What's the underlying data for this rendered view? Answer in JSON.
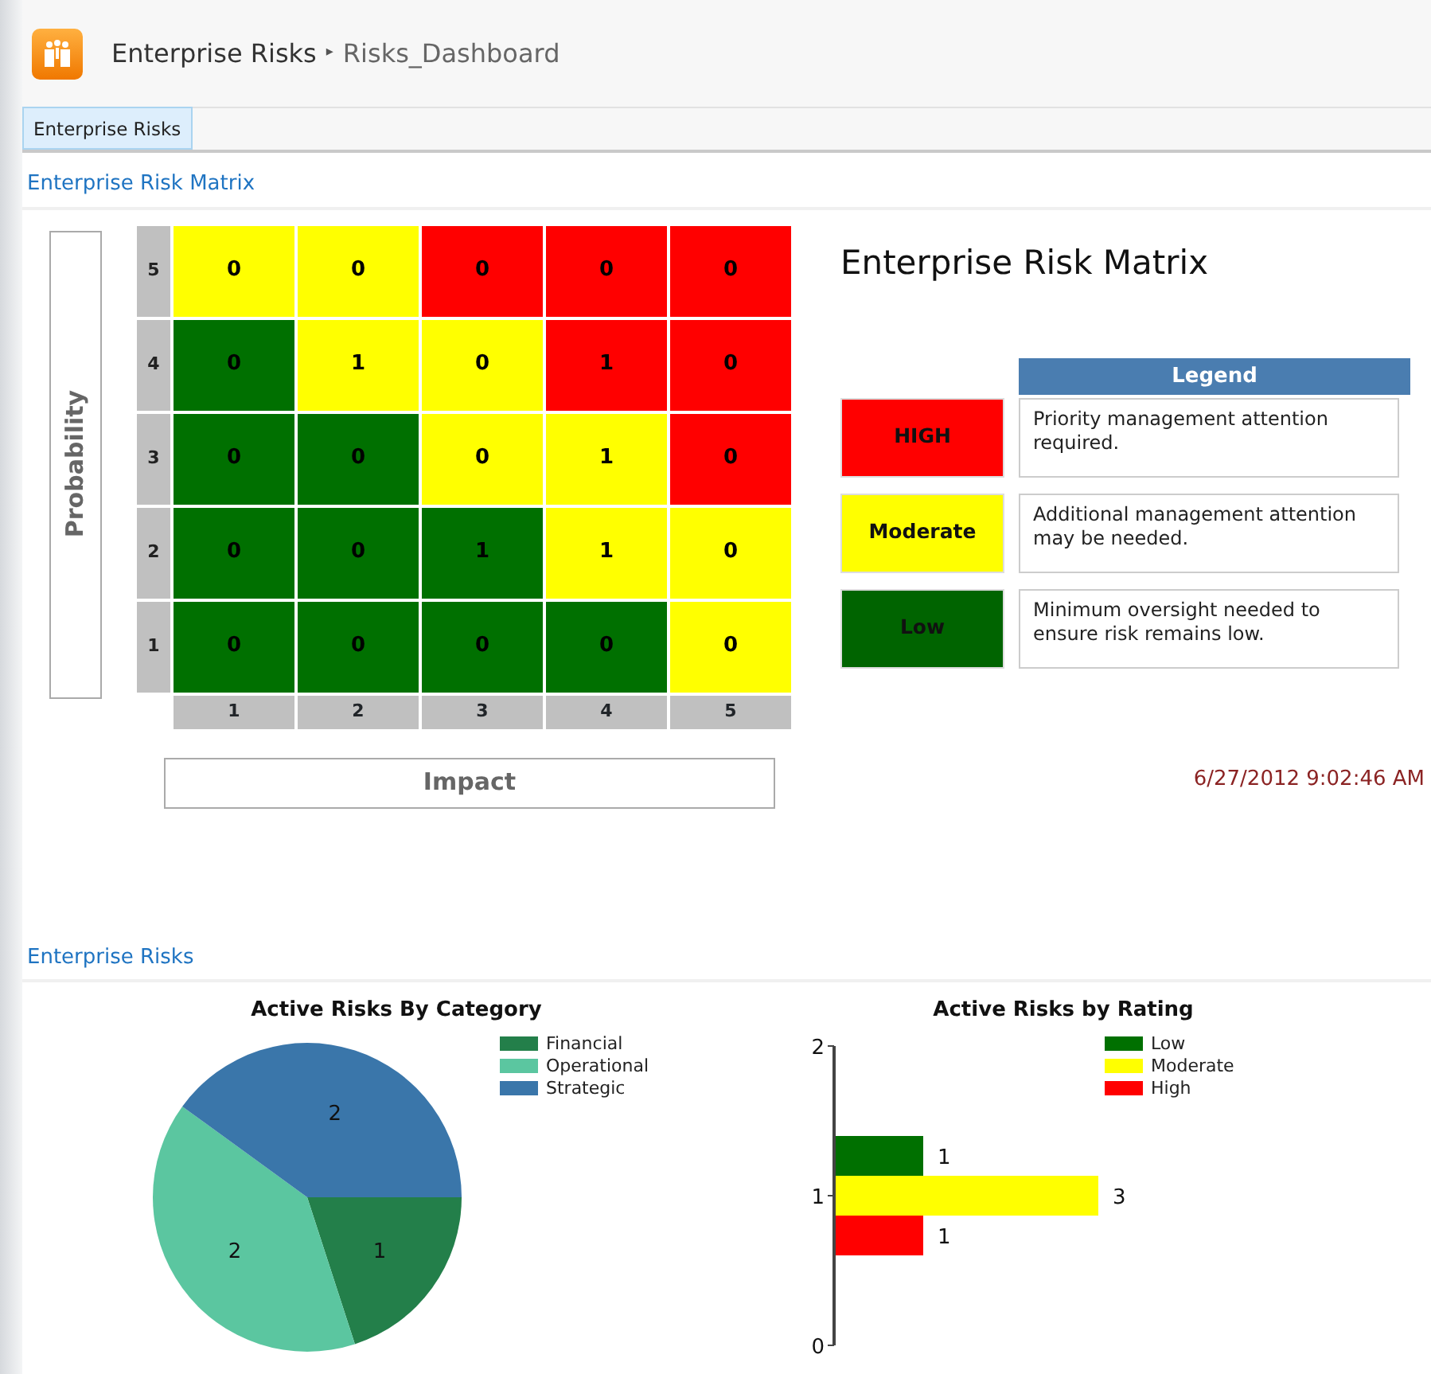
{
  "breadcrumb": {
    "site": "Enterprise Risks",
    "separator": "▸",
    "page": "Risks_Dashboard"
  },
  "tabs": [
    {
      "label": "Enterprise Risks",
      "selected": true
    }
  ],
  "matrix_section": {
    "title": "Enterprise Risk Matrix",
    "y_axis_label": "Probability",
    "x_axis_label": "Impact",
    "rows": [
      {
        "label": "5",
        "cells": [
          {
            "value": "0",
            "color": "#ffff00"
          },
          {
            "value": "0",
            "color": "#ffff00"
          },
          {
            "value": "0",
            "color": "#ff0000"
          },
          {
            "value": "0",
            "color": "#ff0000"
          },
          {
            "value": "0",
            "color": "#ff0000"
          }
        ]
      },
      {
        "label": "4",
        "cells": [
          {
            "value": "0",
            "color": "#007000"
          },
          {
            "value": "1",
            "color": "#ffff00"
          },
          {
            "value": "0",
            "color": "#ffff00"
          },
          {
            "value": "1",
            "color": "#ff0000"
          },
          {
            "value": "0",
            "color": "#ff0000"
          }
        ]
      },
      {
        "label": "3",
        "cells": [
          {
            "value": "0",
            "color": "#007000"
          },
          {
            "value": "0",
            "color": "#007000"
          },
          {
            "value": "0",
            "color": "#ffff00"
          },
          {
            "value": "1",
            "color": "#ffff00"
          },
          {
            "value": "0",
            "color": "#ff0000"
          }
        ]
      },
      {
        "label": "2",
        "cells": [
          {
            "value": "0",
            "color": "#007000"
          },
          {
            "value": "0",
            "color": "#007000"
          },
          {
            "value": "1",
            "color": "#007000"
          },
          {
            "value": "1",
            "color": "#ffff00"
          },
          {
            "value": "0",
            "color": "#ffff00"
          }
        ]
      },
      {
        "label": "1",
        "cells": [
          {
            "value": "0",
            "color": "#007000"
          },
          {
            "value": "0",
            "color": "#007000"
          },
          {
            "value": "0",
            "color": "#007000"
          },
          {
            "value": "0",
            "color": "#007000"
          },
          {
            "value": "0",
            "color": "#ffff00"
          }
        ]
      }
    ],
    "impact_labels": [
      "1",
      "2",
      "3",
      "4",
      "5"
    ],
    "heading": "Enterprise Risk Matrix",
    "legend_title": "Legend",
    "legend": [
      {
        "label": "HIGH",
        "color": "#ff0000",
        "description": "Priority management attention required."
      },
      {
        "label": "Moderate",
        "color": "#ffff00",
        "description": "Additional management attention may be needed."
      },
      {
        "label": "Low",
        "color": "#006400",
        "description": "Minimum oversight needed to ensure risk remains low."
      }
    ],
    "timestamp": "6/27/2012 9:02:46 AM"
  },
  "risks_section": {
    "title": "Enterprise Risks",
    "category_chart": {
      "chart_data": {
        "type": "pie",
        "title": "Active Risks By Category",
        "categories": [
          "Financial",
          "Operational",
          "Strategic"
        ],
        "values": [
          1,
          2,
          2
        ],
        "colors": [
          "#237f4a",
          "#5bc6a0",
          "#3a76aa"
        ],
        "data_labels": true,
        "legend": true
      }
    },
    "rating_chart": {
      "chart_data": {
        "type": "bar",
        "title": "Active Risks by Rating",
        "orientation": "horizontal",
        "categories": [
          "2",
          "1",
          "0"
        ],
        "series": [
          {
            "name": "Low",
            "color": "#007000",
            "values": [
              null,
              1,
              null
            ]
          },
          {
            "name": "Moderate",
            "color": "#ffff00",
            "values": [
              null,
              3,
              null
            ]
          },
          {
            "name": "High",
            "color": "#ff0000",
            "values": [
              null,
              1,
              null
            ]
          }
        ],
        "data_labels": true,
        "legend": true
      }
    }
  }
}
